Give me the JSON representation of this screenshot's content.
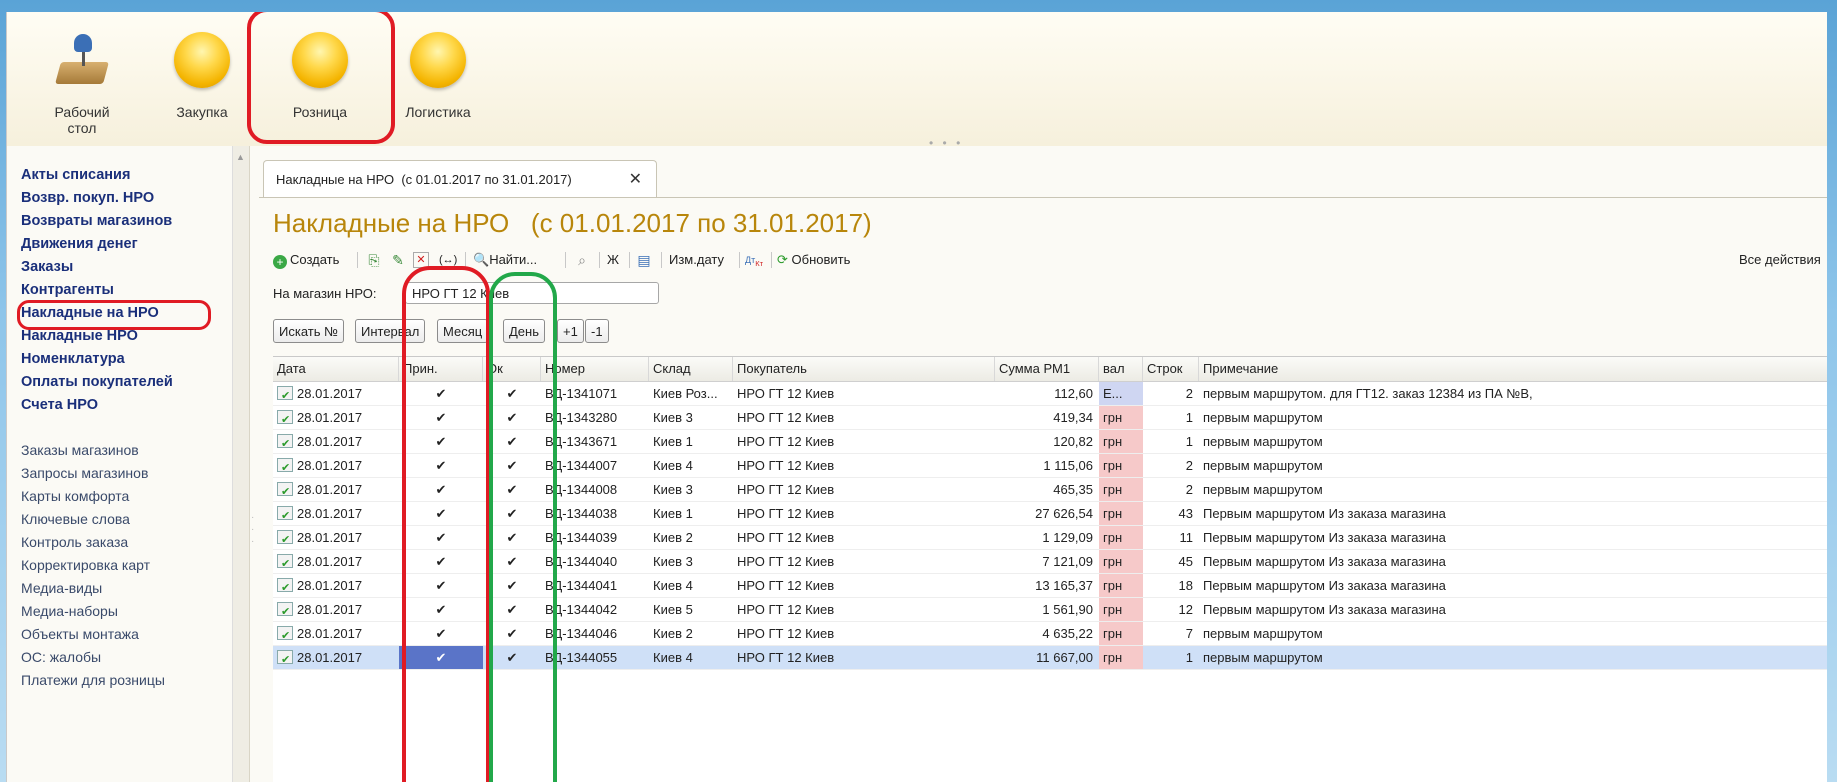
{
  "sections": [
    {
      "label": "Рабочий стол",
      "icon": "desk-lamp-icon"
    },
    {
      "label": "Закупка",
      "icon": "yellow-circle-icon"
    },
    {
      "label": "Розница",
      "icon": "yellow-circle-icon"
    },
    {
      "label": "Логистика",
      "icon": "yellow-circle-icon"
    }
  ],
  "nav": {
    "bold_items": [
      "Акты списания",
      "Возвр. покуп. НРО",
      "Возвраты магазинов",
      "Движения денег",
      "Заказы",
      "Контрагенты",
      "Накладные на НРО",
      "Накладные НРО",
      "Номенклатура",
      "Оплаты покупателей",
      "Счета НРО"
    ],
    "plain_items": [
      "Заказы магазинов",
      "Запросы магазинов",
      "Карты комфорта",
      "Ключевые слова",
      "Контроль заказа",
      "Корректировка карт",
      "Медиа-виды",
      "Медиа-наборы",
      "Объекты монтажа",
      "ОС: жалобы",
      "Платежи для розницы"
    ]
  },
  "tab": {
    "label": "Накладные на НРО  (с 01.01.2017 по 31.01.2017)",
    "close": "✕"
  },
  "title": "Накладные на НРО   (с 01.01.2017 по 31.01.2017)",
  "toolbar": {
    "create": "Создать",
    "find": "Найти...",
    "bold_btn": "Ж",
    "change_date": "Изм.дату",
    "refresh": "Обновить",
    "all_actions": "Все действия"
  },
  "filter": {
    "label": "На магазин НРО:",
    "value": "НРО ГТ 12 Киев"
  },
  "buttons": [
    "Искать №",
    "Интервал",
    "Месяц",
    "День",
    "+1",
    "-1"
  ],
  "columns": [
    "Дата",
    "Прин.",
    "Ок",
    "Номер",
    "Склад",
    "Покупатель",
    "Сумма РМ1",
    "вал",
    "Строк",
    "Примечание"
  ],
  "rows": [
    {
      "date": "28.01.2017",
      "prin": "✔",
      "ok": "✔",
      "num": "ВД-1341071",
      "sklad": "Киев Роз...",
      "buyer": "НРО ГТ 12 Киев",
      "sum": "112,60",
      "val": "Е...",
      "lines": "2",
      "note": "первым маршрутом. для ГТ12. заказ 12384 из ПА №В,"
    },
    {
      "date": "28.01.2017",
      "prin": "✔",
      "ok": "✔",
      "num": "ВД-1343280",
      "sklad": "Киев 3",
      "buyer": "НРО ГТ 12 Киев",
      "sum": "419,34",
      "val": "грн",
      "lines": "1",
      "note": "первым маршрутом"
    },
    {
      "date": "28.01.2017",
      "prin": "✔",
      "ok": "✔",
      "num": "ВД-1343671",
      "sklad": "Киев 1",
      "buyer": "НРО ГТ 12 Киев",
      "sum": "120,82",
      "val": "грн",
      "lines": "1",
      "note": "первым маршрутом"
    },
    {
      "date": "28.01.2017",
      "prin": "✔",
      "ok": "✔",
      "num": "ВД-1344007",
      "sklad": "Киев 4",
      "buyer": "НРО ГТ 12 Киев",
      "sum": "1 115,06",
      "val": "грн",
      "lines": "2",
      "note": "первым маршрутом"
    },
    {
      "date": "28.01.2017",
      "prin": "✔",
      "ok": "✔",
      "num": "ВД-1344008",
      "sklad": "Киев 3",
      "buyer": "НРО ГТ 12 Киев",
      "sum": "465,35",
      "val": "грн",
      "lines": "2",
      "note": "первым маршрутом"
    },
    {
      "date": "28.01.2017",
      "prin": "✔",
      "ok": "✔",
      "num": "ВД-1344038",
      "sklad": "Киев 1",
      "buyer": "НРО ГТ 12 Киев",
      "sum": "27 626,54",
      "val": "грн",
      "lines": "43",
      "note": "Первым маршрутом Из заказа магазина"
    },
    {
      "date": "28.01.2017",
      "prin": "✔",
      "ok": "✔",
      "num": "ВД-1344039",
      "sklad": "Киев 2",
      "buyer": "НРО ГТ 12 Киев",
      "sum": "1 129,09",
      "val": "грн",
      "lines": "11",
      "note": "Первым маршрутом Из заказа магазина"
    },
    {
      "date": "28.01.2017",
      "prin": "✔",
      "ok": "✔",
      "num": "ВД-1344040",
      "sklad": "Киев 3",
      "buyer": "НРО ГТ 12 Киев",
      "sum": "7 121,09",
      "val": "грн",
      "lines": "45",
      "note": "Первым маршрутом Из заказа магазина"
    },
    {
      "date": "28.01.2017",
      "prin": "✔",
      "ok": "✔",
      "num": "ВД-1344041",
      "sklad": "Киев 4",
      "buyer": "НРО ГТ 12 Киев",
      "sum": "13 165,37",
      "val": "грн",
      "lines": "18",
      "note": "Первым маршрутом Из заказа магазина"
    },
    {
      "date": "28.01.2017",
      "prin": "✔",
      "ok": "✔",
      "num": "ВД-1344042",
      "sklad": "Киев 5",
      "buyer": "НРО ГТ 12 Киев",
      "sum": "1 561,90",
      "val": "грн",
      "lines": "12",
      "note": "Первым маршрутом Из заказа магазина"
    },
    {
      "date": "28.01.2017",
      "prin": "✔",
      "ok": "✔",
      "num": "ВД-1344046",
      "sklad": "Киев 2",
      "buyer": "НРО ГТ 12 Киев",
      "sum": "4 635,22",
      "val": "грн",
      "lines": "7",
      "note": "первым маршрутом"
    },
    {
      "date": "28.01.2017",
      "prin": "✔",
      "ok": "✔",
      "num": "ВД-1344055",
      "sklad": "Киев 4",
      "buyer": "НРО ГТ 12 Киев",
      "sum": "11 667,00",
      "val": "грн",
      "lines": "1",
      "note": "первым маршрутом"
    }
  ],
  "selected_row": 11,
  "colors": {
    "title": "#b8860b",
    "highlight_red": "#e01b24",
    "highlight_green": "#22a84a",
    "nav_bold": "#1a2f7a"
  }
}
